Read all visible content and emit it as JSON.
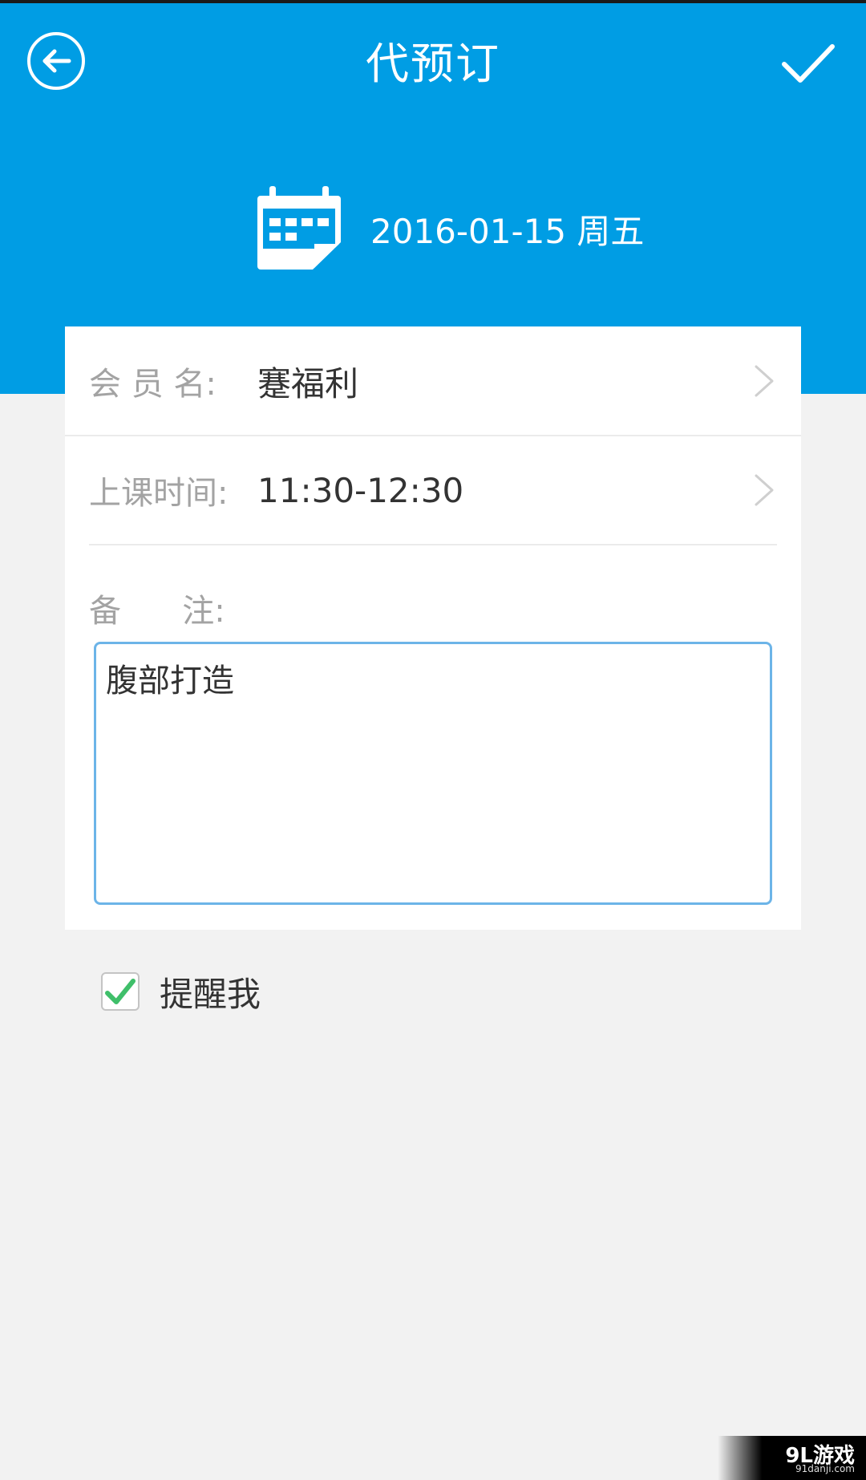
{
  "header": {
    "title": "代预订",
    "back_icon": "back-arrow-icon",
    "confirm_icon": "checkmark-icon",
    "background_color": "#009de4"
  },
  "date": {
    "icon": "calendar-icon",
    "text": "2016-01-15 周五"
  },
  "form": {
    "member": {
      "label": "会 员 名:",
      "value": "蹇福利"
    },
    "class_time": {
      "label": "上课时间:",
      "value": "11:30-12:30"
    },
    "note": {
      "label": "备      注:",
      "value": "腹部打造",
      "border_color": "#6cb4e8"
    }
  },
  "remind": {
    "label": "提醒我",
    "checked": true,
    "check_color": "#3fbf6a"
  },
  "watermark": {
    "logo": "9L游戏",
    "site": "91danji.com"
  }
}
